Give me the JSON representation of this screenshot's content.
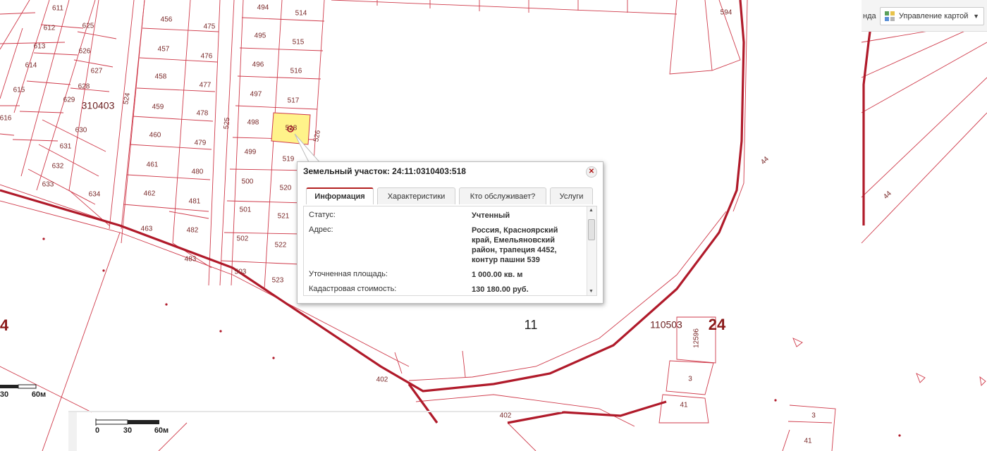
{
  "popup": {
    "title": "Земельный участок: 24:11:0310403:518",
    "tabs": [
      "Информация",
      "Характеристики",
      "Кто обслуживает?",
      "Услуги"
    ],
    "active_tab": 0,
    "rows": [
      {
        "label": "Статус:",
        "value": "Учтенный"
      },
      {
        "label": "Адрес:",
        "value": "Россия, Красноярский край, Емельяновский район, трапеция 4452, контур пашни 539"
      },
      {
        "label": "Уточненная площадь:",
        "value": "1 000.00 кв. м"
      },
      {
        "label": "Кадастровая стоимость:",
        "value": "130 180.00 руб."
      }
    ],
    "accent_color": "#b32020"
  },
  "toolbar": {
    "layer_fragment": "нда",
    "map_control_label": "Управление картой"
  },
  "map": {
    "selected_parcel_label": "518",
    "quarter_labels": [
      "310403",
      "110503",
      "11"
    ],
    "district_numbers": [
      "24",
      "4"
    ],
    "road_labels": [
      "402",
      "402",
      "44",
      "44"
    ],
    "scale_main": [
      "0",
      "30",
      "60м"
    ],
    "scale_left": [
      "30",
      "60м"
    ],
    "selected_fill": "#fff38a",
    "line_color": "#c2293b",
    "road_color": "#b01a2a"
  }
}
